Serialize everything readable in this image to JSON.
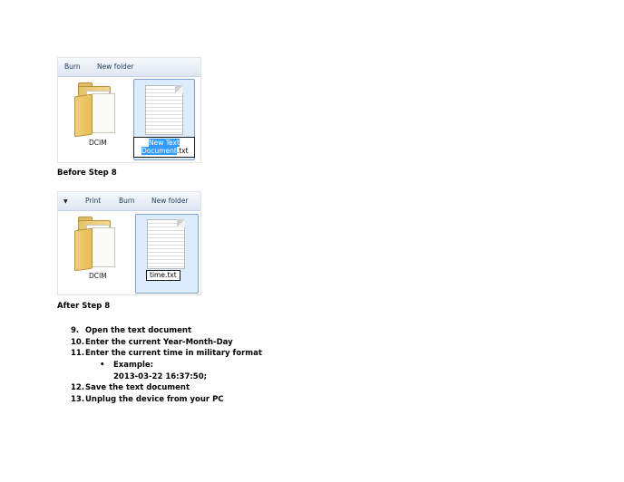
{
  "screenshot_before": {
    "toolbar": {
      "burn": "Burn",
      "new_folder": "New folder"
    },
    "folder_label": "DCIM",
    "file_rename": {
      "selected_part1": "New Text",
      "selected_part2": "Document",
      "unselected": ".txt"
    }
  },
  "caption_before": "Before Step 8",
  "screenshot_after": {
    "toolbar": {
      "arrow": "▼",
      "print": "Print",
      "burn": "Burn",
      "new_folder": "New folder"
    },
    "folder_label": "DCIM",
    "file_name": "time.txt"
  },
  "caption_after": "After Step 8",
  "steps": [
    {
      "num": "9.",
      "text": "Open the text document"
    },
    {
      "num": "10.",
      "text": "Enter the current Year-Month-Day"
    },
    {
      "num": "11.",
      "text": "Enter the current time in military format"
    }
  ],
  "example": {
    "bullet": "•",
    "label": "Example:",
    "value": "2013-03-22 16:37:50;"
  },
  "steps_after": [
    {
      "num": "12.",
      "text": "Save the text document"
    },
    {
      "num": "13.",
      "text": "Unplug the device from your PC"
    }
  ]
}
